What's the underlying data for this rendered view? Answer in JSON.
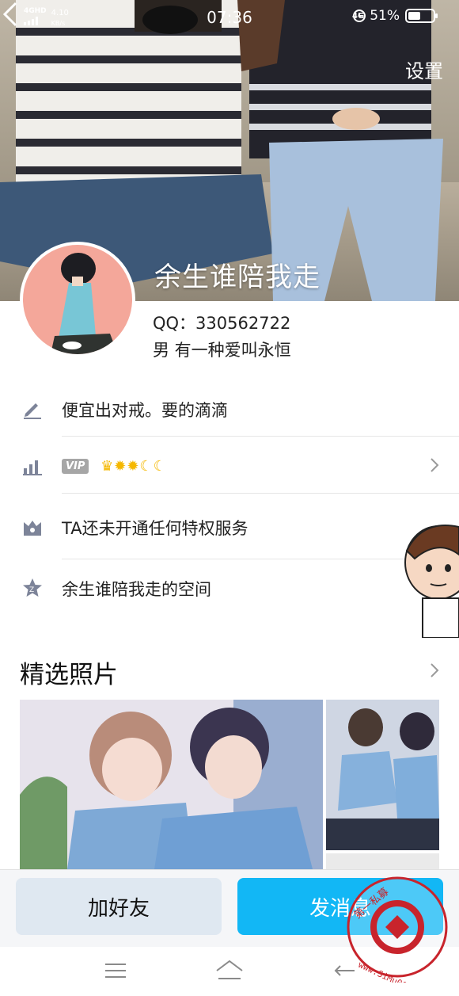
{
  "status_bar": {
    "network": "4GHD",
    "speed": "4.10",
    "speed_unit": "KB/s",
    "time": "07:36",
    "net_type": "4G",
    "battery": "51%",
    "battery_level": 0.51
  },
  "header": {
    "settings_label": "设置",
    "nickname": "余生谁陪我走",
    "qq": "QQ：330562722",
    "info": "男  有一种爱叫永恒"
  },
  "rows": {
    "signature": "便宜出对戒。要的滴滴",
    "vip_badge": "VIP",
    "privilege": "TA还未开通任何特权服务",
    "space": "余生谁陪我走的空间"
  },
  "photos": {
    "section_title": "精选照片"
  },
  "actions": {
    "add_friend": "加好友",
    "send_message": "发消息"
  },
  "icons": {
    "back": "back-arrow-icon",
    "edit": "pencil-icon",
    "level": "level-chart-icon",
    "privilege": "crown-box-icon",
    "space": "star-icon",
    "chevron": "chevron-right-icon",
    "nav_menu": "menu-icon",
    "nav_home": "home-icon",
    "nav_back": "back-icon"
  },
  "colors": {
    "accent": "#12b7f5",
    "add_button": "#dfe8f1",
    "icon_gray": "#7d8499"
  }
}
